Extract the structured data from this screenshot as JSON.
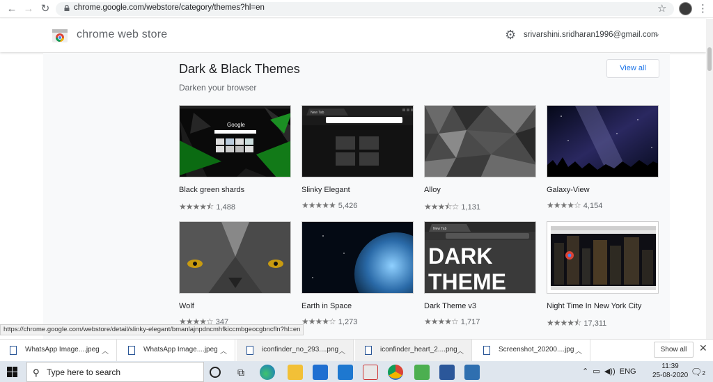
{
  "browser": {
    "url": "chrome.google.com/webstore/category/themes?hl=en",
    "nav_back_icon": "arrow-left-icon",
    "nav_forward_icon": "arrow-right-icon",
    "reload_icon": "reload-icon"
  },
  "store": {
    "title": "chrome web store",
    "account_email": "srivarshini.sridharan1996@gmail.com"
  },
  "section": {
    "title": "Dark & Black Themes",
    "subtitle": "Darken your browser",
    "view_all": "View all"
  },
  "themes": [
    {
      "name": "Black green shards",
      "rating": 4.5,
      "count": "1,488"
    },
    {
      "name": "Slinky Elegant",
      "rating": 5,
      "count": "5,426"
    },
    {
      "name": "Alloy",
      "rating": 3.5,
      "count": "1,131"
    },
    {
      "name": "Galaxy-View",
      "rating": 4,
      "count": "4,154"
    },
    {
      "name": "Wolf",
      "rating": 4,
      "count": "347"
    },
    {
      "name": "Earth in Space",
      "rating": 4,
      "count": "1,273"
    },
    {
      "name": "Dark Theme v3",
      "rating": 4,
      "count": "1,717"
    },
    {
      "name": "Night Time In New York City",
      "rating": 4.5,
      "count": "17,311"
    }
  ],
  "theme_images": {
    "shards_search_text": "Google",
    "slinky_tab_label": "New Tab",
    "dark_theme_line1": "DARK",
    "dark_theme_line2": "THEME",
    "dark_theme_tab": "New Tab"
  },
  "status_bar": "https://chrome.google.com/webstore/detail/slinky-elegant/bmanlajnpdncmhfkiccmbgeocgbncfln?hl=en",
  "downloads": [
    {
      "name": "WhatsApp Image....jpeg"
    },
    {
      "name": "WhatsApp Image....jpeg"
    },
    {
      "name": "iconfinder_no_293....png"
    },
    {
      "name": "iconfinder_heart_2....png"
    },
    {
      "name": "Screenshot_20200....jpg"
    }
  ],
  "show_all": "Show all",
  "taskbar": {
    "search_placeholder": "Type here to search",
    "lang": "ENG",
    "time": "11:39",
    "date": "25-08-2020",
    "notifications": "2"
  },
  "colors": {
    "accent": "#1a73e8",
    "taskbar": "#dfe6ee"
  }
}
